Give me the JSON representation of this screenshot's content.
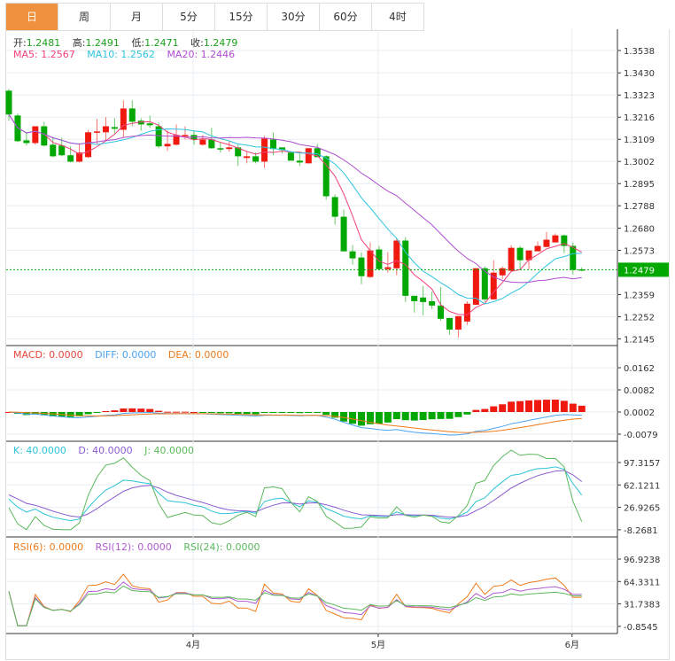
{
  "tabs": [
    {
      "label": "日",
      "active": true
    },
    {
      "label": "周"
    },
    {
      "label": "月"
    },
    {
      "label": "5分"
    },
    {
      "label": "15分"
    },
    {
      "label": "30分"
    },
    {
      "label": "60分"
    },
    {
      "label": "4时"
    }
  ],
  "header": {
    "open_label": "开:",
    "open": "1.2481",
    "high_label": "高:",
    "high": "1.2491",
    "low_label": "低:",
    "low": "1.2471",
    "close_label": "收:",
    "close": "1.2479"
  },
  "ma_legend": {
    "ma5": "MA5: 1.2567",
    "ma10": "MA10: 1.2562",
    "ma20": "MA20: 1.2446"
  },
  "macd_legend": {
    "macd": "MACD: 0.0000",
    "diff": "DIFF: 0.0000",
    "dea": "DEA: 0.0000"
  },
  "kdj_legend": {
    "k": "K: 40.0000",
    "d": "D: 40.0000",
    "j": "J: 40.0000"
  },
  "rsi_legend": {
    "rsi6": "RSI(6): 0.0000",
    "rsi12": "RSI(12): 0.0000",
    "rsi24": "RSI(24): 0.0000"
  },
  "colors": {
    "up": "#f0190f",
    "down": "#02a802",
    "ma5": "#f0407a",
    "ma10": "#2ec4e0",
    "ma20": "#b04cd0",
    "diff": "#4aa3f0",
    "dea": "#f07a1a",
    "k": "#2ec4d6",
    "d": "#8a5cd0",
    "j": "#5cb85c",
    "rsi6": "#f07a1a",
    "rsi12": "#b05cd0",
    "rsi24": "#5cb85c",
    "active_tab": "#f0913f"
  },
  "chart_data": {
    "type": "candlestick",
    "current_price": "1.2479",
    "price_axis": [
      "1.3538",
      "1.3430",
      "1.3323",
      "1.3216",
      "1.3109",
      "1.3002",
      "1.2895",
      "1.2788",
      "1.2680",
      "1.2573",
      "1.2359",
      "1.2252",
      "1.2145"
    ],
    "price_range": [
      1.2145,
      1.3538
    ],
    "macd_axis": [
      "0.0162",
      "0.0082",
      "0.0002",
      "-0.0079"
    ],
    "kdj_axis": [
      "97.3157",
      "62.1211",
      "26.9265",
      "-8.2681"
    ],
    "rsi_axis": [
      "96.9238",
      "64.3311",
      "31.7383",
      "-0.8545"
    ],
    "x_labels": [
      {
        "label": "4月",
        "index": 21
      },
      {
        "label": "5月",
        "index": 42
      },
      {
        "label": "6月",
        "index": 64
      }
    ],
    "ohlc": [
      [
        1.3344,
        1.3353,
        1.3199,
        1.3229
      ],
      [
        1.3224,
        1.3233,
        1.3096,
        1.31
      ],
      [
        1.3104,
        1.3143,
        1.3079,
        1.3091
      ],
      [
        1.3091,
        1.3172,
        1.3083,
        1.3172
      ],
      [
        1.3172,
        1.3194,
        1.3075,
        1.3079
      ],
      [
        1.3083,
        1.3121,
        1.3023,
        1.3027
      ],
      [
        1.3079,
        1.3117,
        1.3027,
        1.3032
      ],
      [
        1.3032,
        1.3075,
        1.2997,
        1.3001
      ],
      [
        1.3001,
        1.3087,
        1.2997,
        1.3045
      ],
      [
        1.3023,
        1.3155,
        1.3019,
        1.3143
      ],
      [
        1.3143,
        1.3207,
        1.3087,
        1.3147
      ],
      [
        1.3143,
        1.3216,
        1.3104,
        1.3172
      ],
      [
        1.3168,
        1.3211,
        1.3138,
        1.316
      ],
      [
        1.3155,
        1.3297,
        1.3117,
        1.3258
      ],
      [
        1.3258,
        1.3297,
        1.3172,
        1.3194
      ],
      [
        1.3199,
        1.3211,
        1.3151,
        1.3181
      ],
      [
        1.3186,
        1.3224,
        1.3164,
        1.3177
      ],
      [
        1.3172,
        1.319,
        1.3066,
        1.3075
      ],
      [
        1.3075,
        1.3151,
        1.3053,
        1.3087
      ],
      [
        1.3083,
        1.3181,
        1.3079,
        1.313
      ],
      [
        1.3126,
        1.3172,
        1.3108,
        1.313
      ],
      [
        1.313,
        1.3151,
        1.3083,
        1.3108
      ],
      [
        1.3083,
        1.313,
        1.3079,
        1.3108
      ],
      [
        1.3108,
        1.3164,
        1.3062,
        1.3066
      ],
      [
        1.3066,
        1.3096,
        1.3045,
        1.3062
      ],
      [
        1.3062,
        1.31,
        1.3049,
        1.307
      ],
      [
        1.307,
        1.3083,
        1.298,
        1.3027
      ],
      [
        1.3019,
        1.3049,
        1.2993,
        1.3027
      ],
      [
        1.3027,
        1.3045,
        1.2993,
        1.3001
      ],
      [
        1.3001,
        1.3126,
        1.2971,
        1.3113
      ],
      [
        1.3108,
        1.3143,
        1.3032,
        1.3062
      ],
      [
        1.307,
        1.307,
        1.304,
        1.3057
      ],
      [
        1.3045,
        1.3049,
        1.3006,
        1.3006
      ],
      [
        1.3006,
        1.304,
        1.298,
        1.2997
      ],
      [
        1.2993,
        1.3066,
        1.2993,
        1.3066
      ],
      [
        1.3066,
        1.3087,
        1.3023,
        1.3023
      ],
      [
        1.3027,
        1.3032,
        1.2817,
        1.2834
      ],
      [
        1.283,
        1.2843,
        1.2697,
        1.2735
      ],
      [
        1.2735,
        1.2769,
        1.2568,
        1.2568
      ],
      [
        1.2568,
        1.2598,
        1.2504,
        1.2534
      ],
      [
        1.2538,
        1.2564,
        1.2409,
        1.2448
      ],
      [
        1.2444,
        1.2611,
        1.2439,
        1.2572
      ],
      [
        1.2577,
        1.2594,
        1.2478,
        1.2482
      ],
      [
        1.2482,
        1.2564,
        1.2465,
        1.2491
      ],
      [
        1.2486,
        1.2632,
        1.2452,
        1.262
      ],
      [
        1.262,
        1.2637,
        1.2323,
        1.2353
      ],
      [
        1.2353,
        1.2353,
        1.2272,
        1.2327
      ],
      [
        1.2345,
        1.2401,
        1.2259,
        1.2323
      ],
      [
        1.2327,
        1.2374,
        1.2289,
        1.2306
      ],
      [
        1.2306,
        1.2396,
        1.2233,
        1.2242
      ],
      [
        1.2246,
        1.2246,
        1.2165,
        1.219
      ],
      [
        1.219,
        1.2255,
        1.2152,
        1.2255
      ],
      [
        1.2229,
        1.2327,
        1.2212,
        1.2315
      ],
      [
        1.231,
        1.2486,
        1.231,
        1.2486
      ],
      [
        1.2486,
        1.2495,
        1.2323,
        1.2336
      ],
      [
        1.2336,
        1.2525,
        1.2336,
        1.2465
      ],
      [
        1.2452,
        1.2495,
        1.2435,
        1.2486
      ],
      [
        1.2474,
        1.2598,
        1.2469,
        1.2585
      ],
      [
        1.2585,
        1.2594,
        1.2482,
        1.2525
      ],
      [
        1.2525,
        1.2572,
        1.2482,
        1.2572
      ],
      [
        1.2568,
        1.2615,
        1.2568,
        1.2594
      ],
      [
        1.2589,
        1.2662,
        1.2589,
        1.2624
      ],
      [
        1.2611,
        1.2654,
        1.2611,
        1.2645
      ],
      [
        1.2645,
        1.2649,
        1.2559,
        1.2594
      ],
      [
        1.2594,
        1.2611,
        1.2456,
        1.2478
      ],
      [
        1.2481,
        1.2491,
        1.2471,
        1.2479
      ]
    ]
  }
}
